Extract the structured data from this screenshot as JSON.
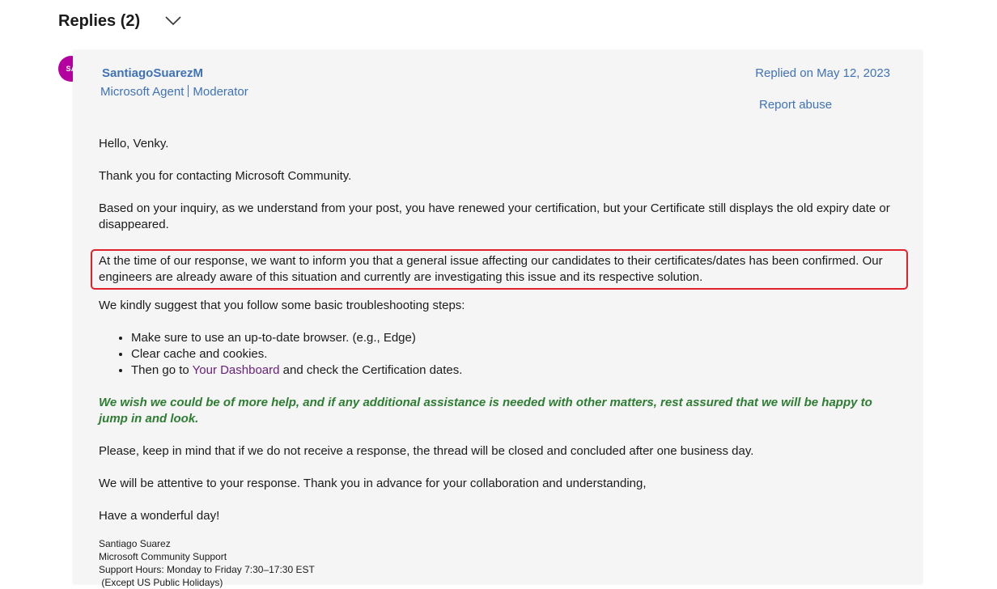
{
  "header": {
    "title": "Replies (2)"
  },
  "reply": {
    "avatar_initials": "SA",
    "author_name": "SantiagoSuarezM",
    "role_1": "Microsoft Agent",
    "role_2": "Moderator",
    "replied_on": "Replied on May 12, 2023",
    "report_abuse": "Report abuse",
    "greeting": "Hello, Venky.",
    "thanks": "Thank you for contacting Microsoft Community.",
    "inquiry": "Based on your inquiry, as we understand from your post, you have renewed your certification, but your Certificate still displays the old expiry date or disappeared.",
    "issue": "At the time of our response, we want to inform you that a general issue affecting our candidates to their certificates/dates has been confirmed. Our engineers are already aware of this situation and currently are investigating this issue and its respective solution.",
    "suggest": "We kindly suggest that you follow some basic troubleshooting steps:",
    "steps": {
      "step_1": "Make sure to use an up-to-date browser. (e.g., Edge)",
      "step_2": "Clear cache and cookies.",
      "step_3_prefix": "Then go to ",
      "step_3_link": "Your Dashboard",
      "step_3_suffix": " and check the Certification dates."
    },
    "help_note": "We wish we could be of more help, and if any additional assistance is needed with other matters, rest assured that we will be happy to jump in and look.",
    "closing_notice": "Please, keep in mind that if we do not receive a response, the thread will be closed and concluded after one business day.",
    "attentive": "We will be attentive to your response. Thank you in advance for your collaboration and understanding,",
    "farewell": "Have a wonderful day!",
    "signature": {
      "name": "Santiago Suarez",
      "org": "Microsoft Community Support",
      "hours": "Support Hours: Monday to Friday 7:30–17:30 EST",
      "holidays": " (Except US Public Holidays)"
    }
  },
  "colors": {
    "link_blue": "#3f72b9",
    "avatar_bg": "#b4009e",
    "highlight_red": "#e0202a",
    "note_green": "#2d7d32",
    "link_purple": "#68217a"
  }
}
